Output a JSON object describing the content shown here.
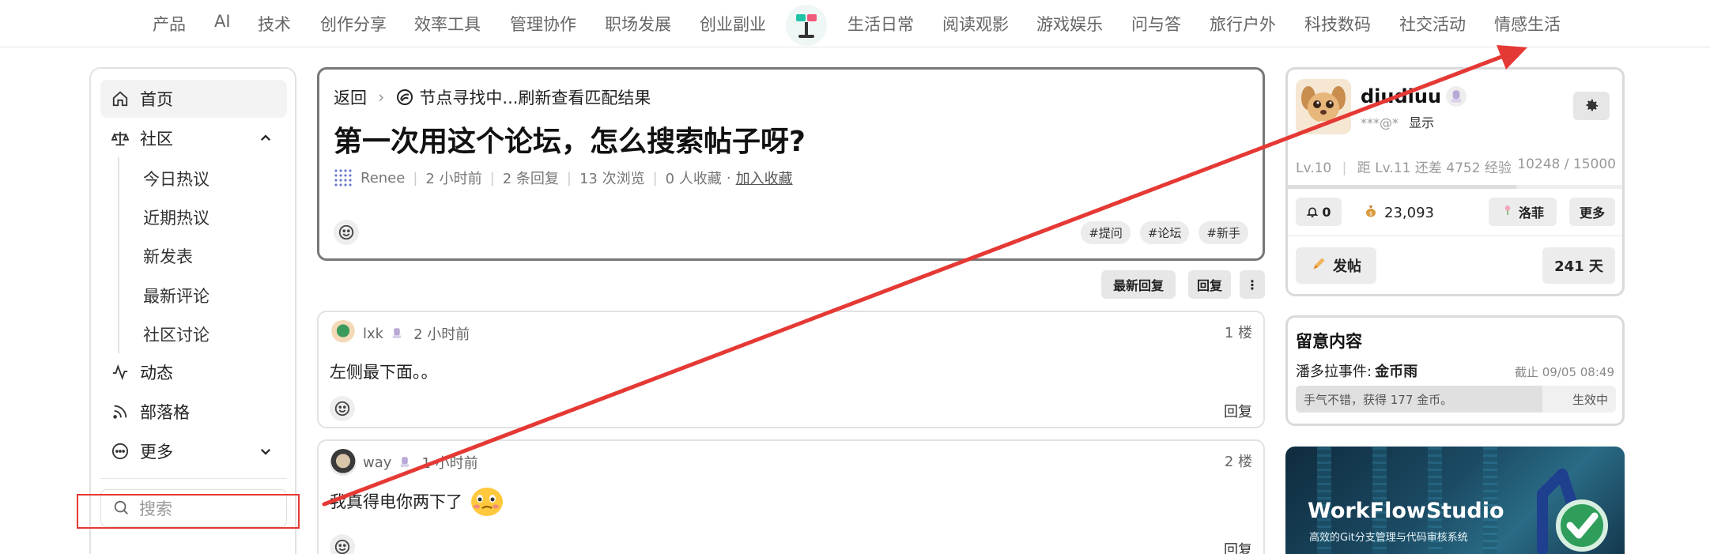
{
  "topnav": {
    "items": [
      "产品",
      "AI",
      "技术",
      "创作分享",
      "效率工具",
      "管理协作",
      "职场发展",
      "创业副业",
      "生活日常",
      "阅读观影",
      "游戏娱乐",
      "问与答",
      "旅行户外",
      "科技数码",
      "社交活动",
      "情感生活"
    ]
  },
  "sidebar": {
    "home": "首页",
    "community": "社区",
    "sub": [
      "今日热议",
      "近期热议",
      "新发表",
      "最新评论",
      "社区讨论"
    ],
    "activity": "动态",
    "blog": "部落格",
    "more": "更多",
    "search_placeholder": "搜索"
  },
  "post": {
    "back": "返回",
    "node": "节点寻找中...刷新查看匹配结果",
    "title": "第一次用这个论坛，怎么搜索帖子呀?",
    "author": "Renee",
    "time": "2 小时前",
    "replies": "2 条回复",
    "views": "13 次浏览",
    "favorites": "0 人收藏",
    "add_favorite": "加入收藏",
    "tags": [
      "#提问",
      "#论坛",
      "#新手"
    ]
  },
  "toolbar": {
    "latest": "最新回复",
    "reply": "回复",
    "more": "⋮"
  },
  "replies": [
    {
      "user": "lxk",
      "time": "2 小时前",
      "floor": "1 楼",
      "content": "左侧最下面。。",
      "reply": "回复"
    },
    {
      "user": "way",
      "time": "1 小时前",
      "floor": "2 楼",
      "content": "我真得电你两下了",
      "reply": "回复"
    }
  ],
  "user": {
    "name": "diudiuu",
    "email": "***@*",
    "show": "显示",
    "level": "Lv.10",
    "next": "距 Lv.11 还差 4752 经验",
    "xp": "10248 / 15000",
    "xp_fraction": 0.683,
    "notifications": "0",
    "coins": "23,093",
    "luofei": "洛菲",
    "more": "更多",
    "post": "发帖",
    "days": "241 天"
  },
  "notice": {
    "title": "留意内容",
    "event_label": "潘多拉事件:",
    "event_name": "金币雨",
    "deadline": "截止 09/05 08:49",
    "message": "手气不错，获得 177 金币。",
    "status": "生效中",
    "progress_fraction": 0.77
  },
  "ad": {
    "title": "WorkFlowStudio",
    "subtitle": "高效的Git分支管理与代码审核系统"
  },
  "colors": {
    "annotation_red": "#e53935"
  }
}
